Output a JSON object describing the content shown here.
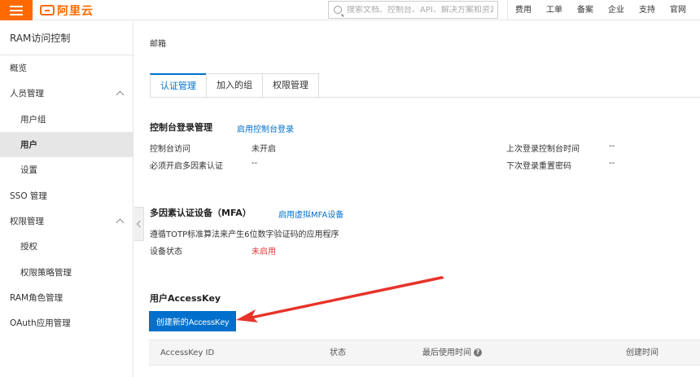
{
  "brand": {
    "name": "阿里云",
    "color": "#ff6a00"
  },
  "search": {
    "placeholder": "搜索文档、控制台、API、解决方案和资源"
  },
  "nav": [
    "费用",
    "工单",
    "备案",
    "企业",
    "支持",
    "官网"
  ],
  "sidebar": {
    "title": "RAM访问控制",
    "items": [
      {
        "label": "概览"
      },
      {
        "label": "人员管理"
      },
      {
        "label": "用户组"
      },
      {
        "label": "用户"
      },
      {
        "label": "设置"
      },
      {
        "label": "SSO 管理"
      },
      {
        "label": "权限管理"
      },
      {
        "label": "授权"
      },
      {
        "label": "权限策略管理"
      },
      {
        "label": "RAM角色管理"
      },
      {
        "label": "OAuth应用管理"
      }
    ]
  },
  "profile": {
    "email_label": "邮箱"
  },
  "tabs": [
    "认证管理",
    "加入的组",
    "权限管理"
  ],
  "console_login": {
    "title": "控制台登录管理",
    "action": "启用控制台登录",
    "rows": [
      {
        "label": "控制台访问",
        "value": "未开启"
      },
      {
        "label": "必须开启多因素认证",
        "value": "--"
      },
      {
        "label": "上次登录控制台时间",
        "value": "--"
      },
      {
        "label": "下次登录重置密码",
        "value": "--"
      }
    ]
  },
  "mfa": {
    "title": "多因素认证设备（MFA）",
    "action": "启用虚拟MFA设备",
    "description": "遵循TOTP标准算法来产生6位数字验证码的应用程序",
    "status_label": "设备状态",
    "status_value": "未启用",
    "status_color": "#e4393c"
  },
  "access_key": {
    "title": "用户AccessKey",
    "create_button": "创建新的AccessKey",
    "columns": [
      "AccessKey ID",
      "状态",
      "最后使用时间",
      "创建时间"
    ],
    "help_icon": "?"
  },
  "accent_color": "#0070cc",
  "annotation_arrow_color": "#e8322a"
}
